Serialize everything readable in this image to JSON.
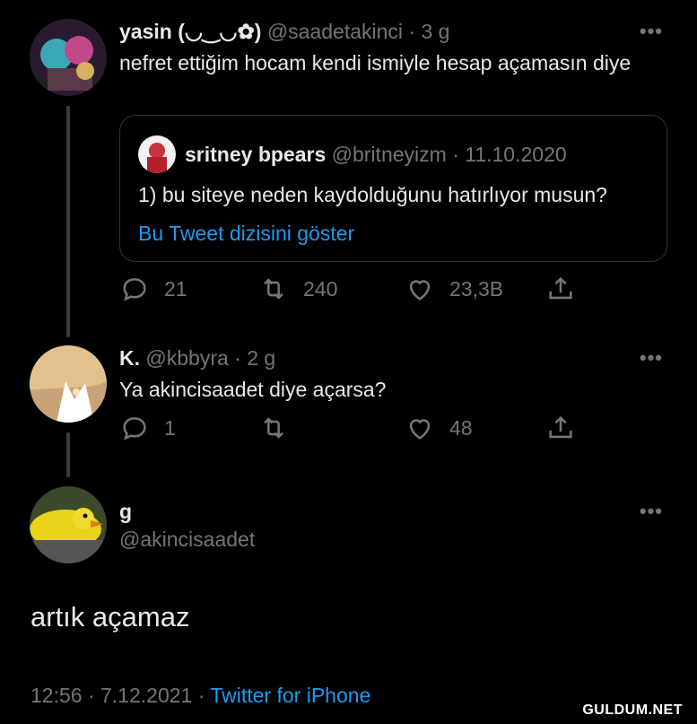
{
  "tweets": [
    {
      "name": "yasin (◡‿◡✿)",
      "handle": "@saadetakinci",
      "sep": "·",
      "time": "3 g",
      "text": "nefret ettiğim hocam kendi ismiyle hesap açamasın diye",
      "quote": {
        "name": "sritney bpears",
        "handle": "@britneyizm",
        "sep": "·",
        "time": "11.10.2020",
        "text": "1) bu siteye neden kaydolduğunu hatırlıyor musun?",
        "link": "Bu Tweet dizisini göster"
      },
      "replies": "21",
      "retweets": "240",
      "likes": "23,3B"
    },
    {
      "name": "K.",
      "handle": "@kbbyra",
      "sep": "·",
      "time": "2 g",
      "text": "Ya akincisaadet diye açarsa?",
      "replies": "1",
      "retweets": "",
      "likes": "48"
    },
    {
      "name": "g",
      "handle": "@akincisaadet",
      "text": "artık açamaz",
      "timestamp": "12:56 · 7.12.2021 ·",
      "source": "Twitter for iPhone"
    }
  ],
  "more_label": "•••",
  "watermark": "GULDUM.NET",
  "colors": {
    "background": "#000000",
    "text": "#e7e9ea",
    "muted": "#71767b",
    "link": "#1d9bf0",
    "border": "#2f3336"
  },
  "icons": [
    "reply-icon",
    "retweet-icon",
    "like-icon",
    "share-icon",
    "more-icon"
  ]
}
